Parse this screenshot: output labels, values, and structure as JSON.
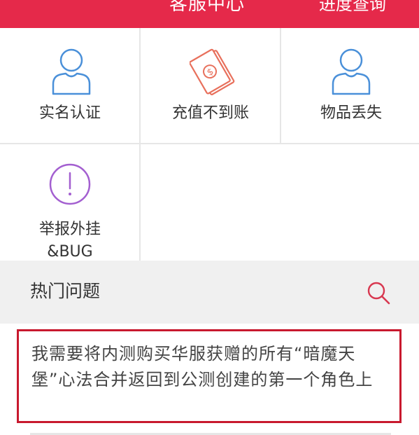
{
  "header": {
    "title": "客服中心",
    "progress_link": "进度查询",
    "bg_color": "#e5294a"
  },
  "services": [
    {
      "label": "实名认证",
      "icon": "user-icon",
      "color": "#4a90d9"
    },
    {
      "label": "充值不到账",
      "icon": "money-card-icon",
      "color": "#e8705c"
    },
    {
      "label": "物品丢失",
      "icon": "user-icon",
      "color": "#4a90d9"
    },
    {
      "label_line1": "举报外挂",
      "label_line2": "&BUG",
      "icon": "exclamation-icon",
      "color": "#a35fd0"
    }
  ],
  "hot_questions": {
    "title": "热门问题",
    "search_icon": "search-icon",
    "items": [
      "我需要将内测购买华服获赠的所有“暗魔天堡”心法合并返回到公测创建的第一个角色上"
    ]
  },
  "accent": "#c8192e"
}
